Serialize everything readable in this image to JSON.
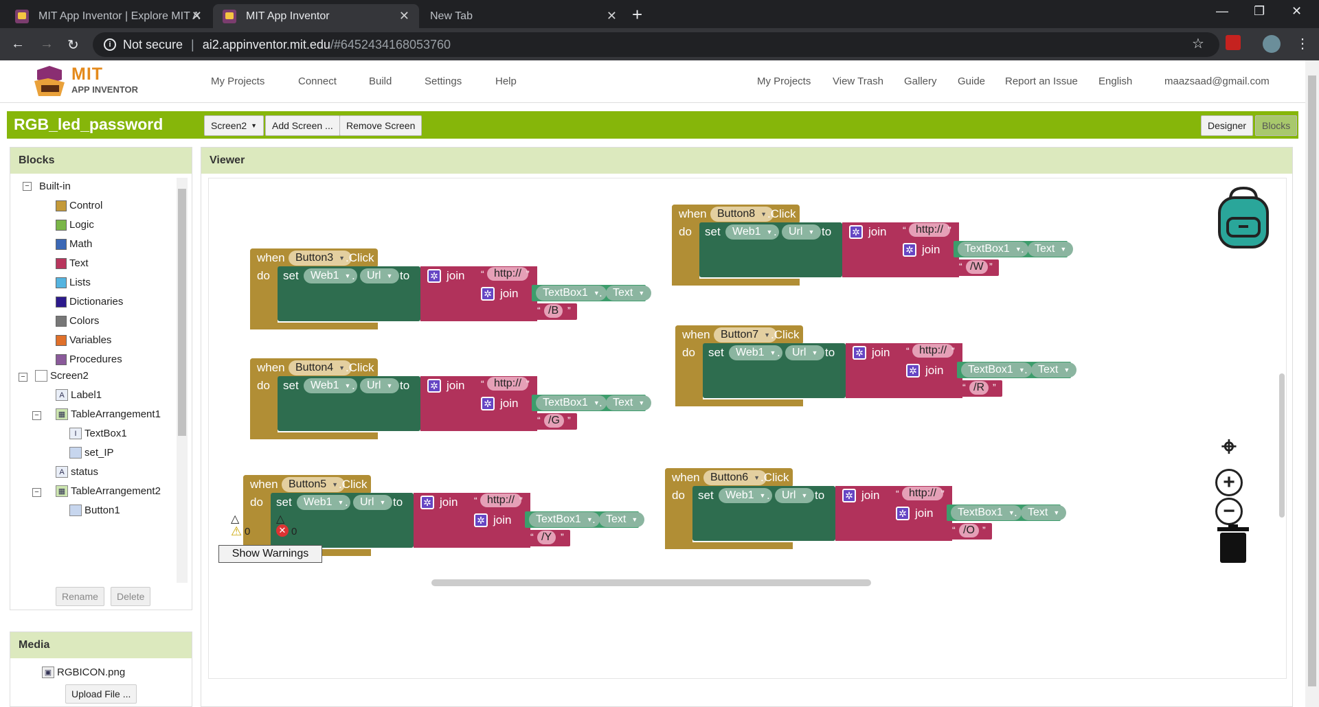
{
  "browser": {
    "tabs": [
      {
        "title": "MIT App Inventor | Explore MIT A"
      },
      {
        "title": "MIT App Inventor"
      },
      {
        "title": "New Tab"
      }
    ],
    "security": "Not secure",
    "url_host": "ai2.appinventor.mit.edu",
    "url_path": "/#6452434168053760"
  },
  "header": {
    "logo_line1": "MIT",
    "logo_line2": "APP INVENTOR",
    "left_menu": [
      "My Projects",
      "Connect",
      "Build",
      "Settings",
      "Help"
    ],
    "right_links": [
      "My Projects",
      "View Trash",
      "Gallery",
      "Guide",
      "Report an Issue"
    ],
    "language": "English",
    "user": "maazsaad@gmail.com"
  },
  "toolbar": {
    "project": "RGB_led_password",
    "screen_select": "Screen2",
    "add_screen": "Add Screen ...",
    "remove_screen": "Remove Screen",
    "designer": "Designer",
    "blocks": "Blocks"
  },
  "blocks_panel": {
    "title": "Blocks",
    "builtin": "Built-in",
    "categories": [
      {
        "label": "Control",
        "color": "#c49a3a"
      },
      {
        "label": "Logic",
        "color": "#7ab648"
      },
      {
        "label": "Math",
        "color": "#3b68b6"
      },
      {
        "label": "Text",
        "color": "#b8365d"
      },
      {
        "label": "Lists",
        "color": "#55b4e0"
      },
      {
        "label": "Dictionaries",
        "color": "#2c1a8c"
      },
      {
        "label": "Colors",
        "color": "#777777"
      },
      {
        "label": "Variables",
        "color": "#e0702a"
      },
      {
        "label": "Procedures",
        "color": "#8a5a9a"
      }
    ],
    "screen": "Screen2",
    "components": [
      "Label1",
      "TableArrangement1",
      "TextBox1",
      "set_IP",
      "status",
      "TableArrangement2",
      "Button1"
    ],
    "rename": "Rename",
    "delete": "Delete"
  },
  "media": {
    "title": "Media",
    "file": "RGBICON.png",
    "upload": "Upload File ..."
  },
  "viewer": {
    "title": "Viewer",
    "kw_when": "when",
    "kw_do": "do",
    "kw_set": "set",
    "kw_to": "to",
    "kw_join": "join",
    "event": ".Click",
    "component_web": "Web1",
    "prop_url": "Url",
    "textbox": "TextBox1",
    "prop_text": "Text",
    "http": "http://",
    "events": [
      {
        "button": "Button3",
        "suffix": "/B"
      },
      {
        "button": "Button4",
        "suffix": "/G"
      },
      {
        "button": "Button5",
        "suffix": "/Y"
      },
      {
        "button": "Button8",
        "suffix": "/W"
      },
      {
        "button": "Button7",
        "suffix": "/R"
      },
      {
        "button": "Button6",
        "suffix": "/O"
      }
    ],
    "warnings_count": "0",
    "errors_count": "0",
    "show_warnings": "Show Warnings"
  }
}
